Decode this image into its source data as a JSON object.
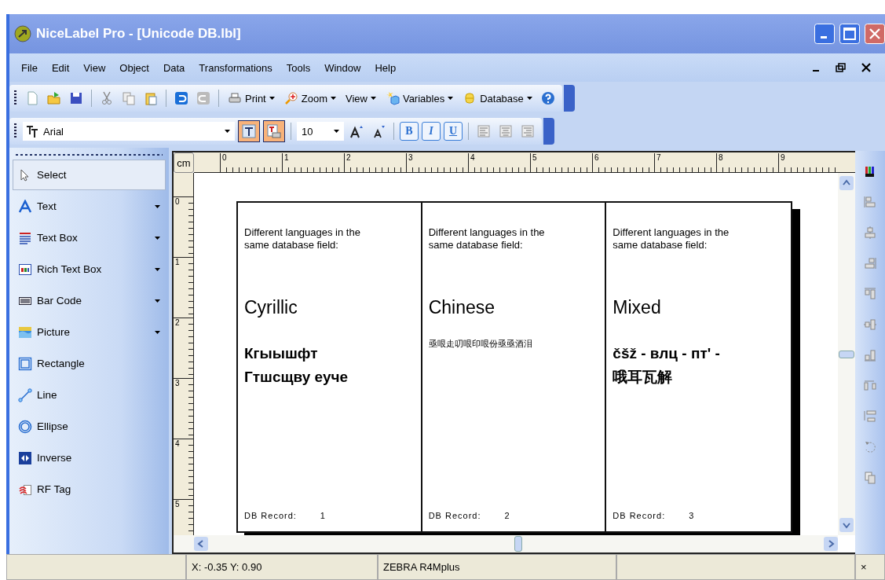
{
  "window": {
    "title": "NiceLabel Pro - [Unicode DB.lbl]"
  },
  "menu": {
    "items": [
      "File",
      "Edit",
      "View",
      "Object",
      "Data",
      "Transformations",
      "Tools",
      "Window",
      "Help"
    ]
  },
  "toolbar": {
    "dropdowns": [
      "Print",
      "Zoom",
      "View",
      "Variables",
      "Database"
    ]
  },
  "format_bar": {
    "font": "Arial",
    "size": "10",
    "toggles": [
      {
        "selected": true
      },
      {
        "selected": true
      }
    ],
    "styles": [
      {
        "label": "B",
        "selected": false
      },
      {
        "label": "I",
        "selected": false
      },
      {
        "label": "U",
        "selected": false
      }
    ]
  },
  "tools": [
    {
      "label": "Select",
      "selected": true,
      "has_menu": false
    },
    {
      "label": "Text",
      "selected": false,
      "has_menu": true
    },
    {
      "label": "Text Box",
      "selected": false,
      "has_menu": true
    },
    {
      "label": "Rich Text Box",
      "selected": false,
      "has_menu": true
    },
    {
      "label": "Bar Code",
      "selected": false,
      "has_menu": true
    },
    {
      "label": "Picture",
      "selected": false,
      "has_menu": true
    },
    {
      "label": "Rectangle",
      "selected": false,
      "has_menu": false
    },
    {
      "label": "Line",
      "selected": false,
      "has_menu": false
    },
    {
      "label": "Ellipse",
      "selected": false,
      "has_menu": false
    },
    {
      "label": "Inverse",
      "selected": false,
      "has_menu": false
    },
    {
      "label": "RF Tag",
      "selected": false,
      "has_menu": false
    }
  ],
  "ruler": {
    "unit": "cm",
    "h_marks": [
      "0",
      "1",
      "2",
      "3",
      "4",
      "5",
      "6",
      "7",
      "8",
      "9"
    ],
    "v_marks": [
      "0",
      "1",
      "2",
      "3",
      "4",
      "5"
    ]
  },
  "labels": [
    {
      "heading": "Different languages in the same database field:",
      "title": "Cyrillic",
      "value": "Кгыышфт Гтшсщву еуче",
      "record_label": "DB Record:",
      "record": "1"
    },
    {
      "heading": "Different languages in the same database field:",
      "title": "Chinese",
      "value": "亟哏走叨哏印哏份亟亟酒泪",
      "record_label": "DB Record:",
      "record": "2"
    },
    {
      "heading": "Different languages in the same database field:",
      "title": "Mixed",
      "value": "čšž - влц - пт' - 哦耳瓦解",
      "record_label": "DB Record:",
      "record": "3"
    }
  ],
  "status_bar": {
    "coordinates": "X: -0.35 Y:  0.90",
    "printer": "ZEBRA R4Mplus",
    "corner": "×"
  }
}
